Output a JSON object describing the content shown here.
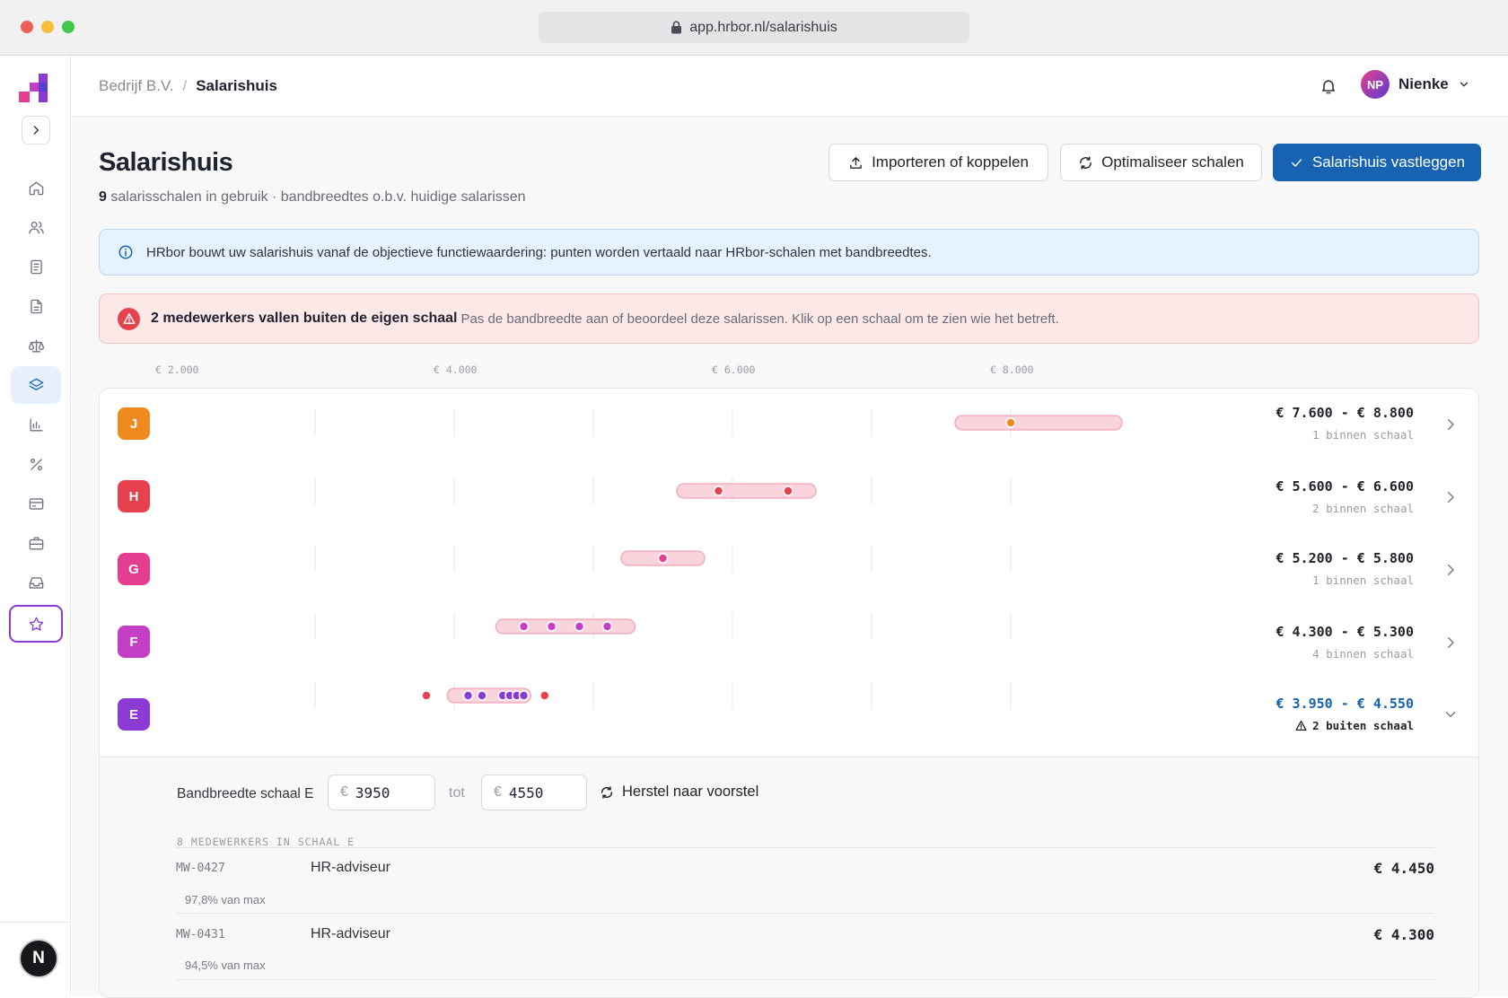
{
  "window": {
    "url": "app.hrbor.nl/salarishuis"
  },
  "breadcrumb": {
    "company": "Bedrijf B.V.",
    "separator": "/",
    "current": "Salarishuis"
  },
  "user": {
    "initials": "NP",
    "name": "Nienke"
  },
  "page": {
    "title": "Salarishuis",
    "subtitle_count": "9",
    "subtitle_text": "salarisschalen in gebruik · bandbreedtes o.b.v. huidige salarissen"
  },
  "actions": {
    "import": "Importeren of koppelen",
    "optimize": "Optimaliseer schalen",
    "commit": "Salarishuis vastleggen"
  },
  "info_banner": {
    "text": "HRbor bouwt uw salarishuis vanaf de objectieve functiewaardering: punten worden vertaald naar HRbor-schalen met bandbreedtes."
  },
  "alert_banner": {
    "title": "2 medewerkers vallen buiten de eigen schaal",
    "text": "Pas de bandbreedte aan of beoordeel deze salarissen. Klik op een schaal om te zien wie het betreft."
  },
  "axis_ticks": [
    "€ 2.000",
    "€ 4.000",
    "€ 6.000",
    "€ 8.000"
  ],
  "chart_data": {
    "type": "range",
    "x_ticks": [
      2000,
      4000,
      6000,
      8000
    ],
    "x_tick_labels": [
      "€ 2.000",
      "€ 4.000",
      "€ 6.000",
      "€ 8.000"
    ],
    "x_range": [
      1000,
      10000
    ],
    "scales": [
      {
        "name": "J",
        "color": "#ee8a1f",
        "min": 7600,
        "max": 8800,
        "range_label": "€ 7.600 - € 8.800",
        "status": "1 binnen schaal",
        "out_of_range": false,
        "salaries": [
          8000
        ]
      },
      {
        "name": "H",
        "color": "#e8414e",
        "min": 5600,
        "max": 6600,
        "range_label": "€ 5.600 - € 6.600",
        "status": "2 binnen schaal",
        "out_of_range": false,
        "salaries": [
          5900,
          6400
        ]
      },
      {
        "name": "G",
        "color": "#e53d8f",
        "min": 5200,
        "max": 5800,
        "range_label": "€ 5.200 - € 5.800",
        "status": "1 binnen schaal",
        "out_of_range": false,
        "salaries": [
          5500
        ]
      },
      {
        "name": "F",
        "color": "#c43fc6",
        "min": 4300,
        "max": 5300,
        "range_label": "€ 4.300 - € 5.300",
        "status": "4 binnen schaal",
        "out_of_range": false,
        "salaries": [
          4500,
          4700,
          4900,
          5100
        ]
      },
      {
        "name": "E",
        "color": "#8b3bd3",
        "min": 3950,
        "max": 4550,
        "range_label": "€ 3.950 - € 4.550",
        "status": "2 buiten schaal",
        "out_of_range": true,
        "salaries": [
          3800,
          4100,
          4200,
          4350,
          4400,
          4450,
          4500,
          4650
        ]
      }
    ]
  },
  "scale_detail": {
    "label": "Bandbreedte schaal E",
    "currency": "€",
    "min_value": "3950",
    "to_word": "tot",
    "max_value": "4550",
    "reset": "Herstel naar voorstel",
    "employees_heading": "8 MEDEWERKERS IN SCHAAL E",
    "employees": [
      {
        "id": "MW-0427",
        "role": "HR-adviseur",
        "salary": "€ 4.450",
        "pct": "97,8% van max"
      },
      {
        "id": "MW-0431",
        "role": "HR-adviseur",
        "salary": "€ 4.300",
        "pct": "94,5% van max"
      }
    ]
  },
  "sidebar_avatar": "N"
}
